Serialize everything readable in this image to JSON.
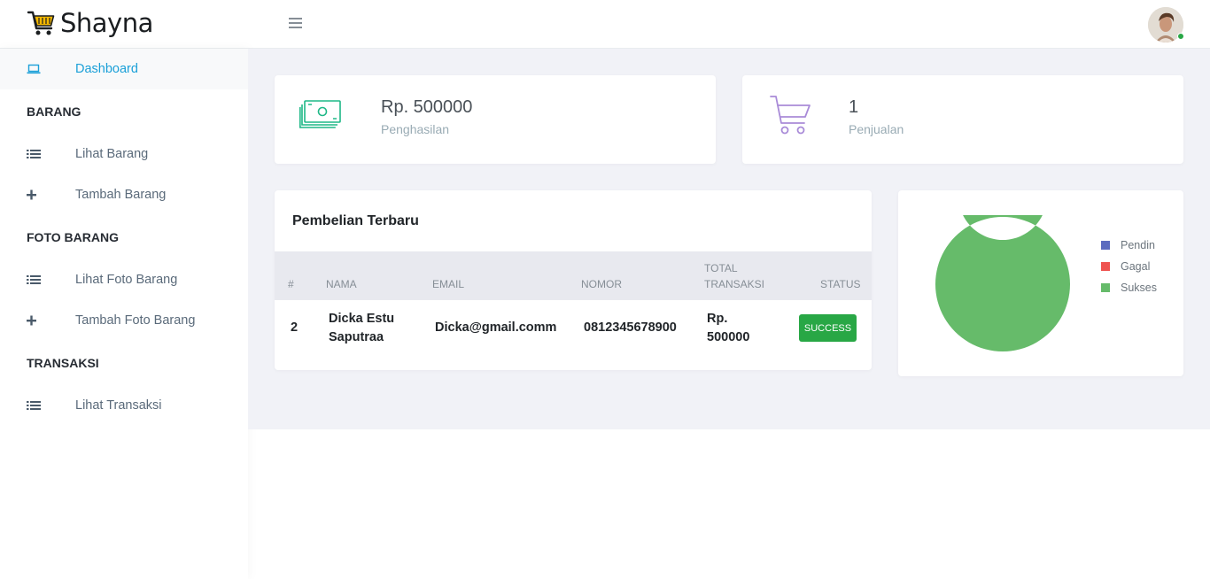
{
  "app": {
    "name": "Shayna"
  },
  "sidebar": {
    "dashboard": "Dashboard",
    "sections": {
      "barang": "BARANG",
      "foto_barang": "FOTO BARANG",
      "transaksi": "TRANSAKSI"
    },
    "items": {
      "lihat_barang": "Lihat Barang",
      "tambah_barang": "Tambah Barang",
      "lihat_foto_barang": "Lihat Foto Barang",
      "tambah_foto_barang": "Tambah Foto Barang",
      "lihat_transaksi": "Lihat Transaksi"
    }
  },
  "stats": {
    "income": {
      "value": "Rp. 500000",
      "label": "Penghasilan"
    },
    "sales": {
      "value": "1",
      "label": "Penjualan"
    }
  },
  "recent": {
    "title": "Pembelian Terbaru",
    "headers": {
      "no": "#",
      "nama": "NAMA",
      "email": "EMAIL",
      "nomor": "NOMOR",
      "total_1": "TOTAL",
      "total_2": "TRANSAKSI",
      "status": "STATUS"
    },
    "rows": [
      {
        "no": "2",
        "nama_1": "Dicka Estu",
        "nama_2": "Saputraa",
        "email": "Dicka@gmail.comm",
        "nomor": "0812345678900",
        "total_1": "Rp.",
        "total_2": "500000",
        "status": "SUCCESS"
      }
    ]
  },
  "chart_data": {
    "type": "pie",
    "categories": [
      "Pendin",
      "Gagal",
      "Sukses"
    ],
    "values": [
      0,
      0,
      1
    ],
    "colors": [
      "#5b6bbf",
      "#ef5350",
      "#66bb6a"
    ],
    "legend": "right"
  },
  "colors": {
    "accent": "#1ba0d8",
    "success": "#28a745",
    "income_icon": "#1fb887",
    "sales_icon": "#a98bd8"
  }
}
